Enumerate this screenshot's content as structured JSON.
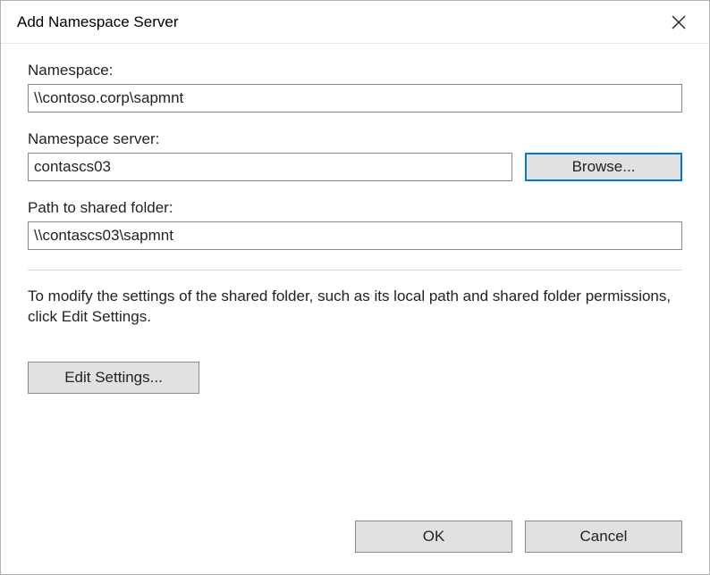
{
  "window": {
    "title": "Add Namespace Server"
  },
  "fields": {
    "namespace": {
      "label": "Namespace:",
      "value": "\\\\contoso.corp\\sapmnt"
    },
    "server": {
      "label": "Namespace server:",
      "value": "contascs03",
      "browse_label": "Browse..."
    },
    "path": {
      "label": "Path to shared folder:",
      "value": "\\\\contascs03\\sapmnt"
    }
  },
  "help_text": "To modify the settings of the shared folder, such as its local path and shared folder permissions, click Edit Settings.",
  "buttons": {
    "edit_settings": "Edit Settings...",
    "ok": "OK",
    "cancel": "Cancel"
  }
}
